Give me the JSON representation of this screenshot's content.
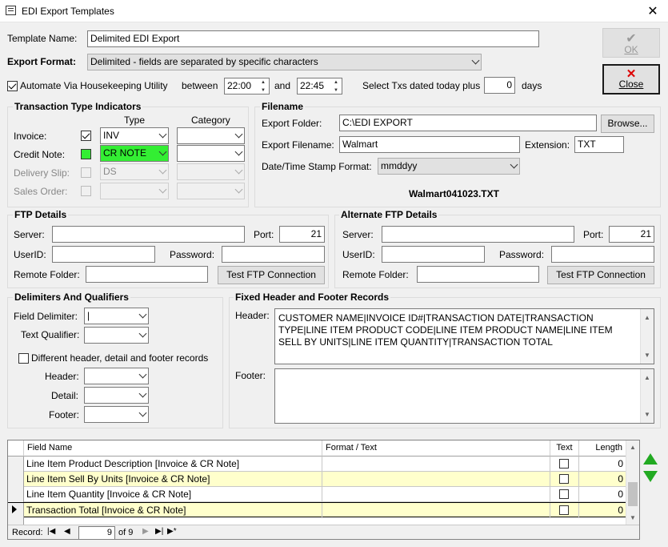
{
  "window": {
    "title": "EDI Export Templates",
    "close_glyph": "✕"
  },
  "buttons": {
    "ok": "OK",
    "close": "Close"
  },
  "template": {
    "name_label": "Template Name:",
    "name_value": "Delimited EDI Export",
    "format_label": "Export Format:",
    "format_value": "Delimited - fields are separated by specific characters"
  },
  "housekeeping": {
    "automate_label": "Automate Via Housekeeping Utility",
    "between_label": "between",
    "from_time": "22:00",
    "and_label": "and",
    "to_time": "22:45",
    "select_label": "Select Txs dated today plus",
    "days_value": "0",
    "days_label": "days"
  },
  "tti": {
    "title": "Transaction Type Indicators",
    "type_header": "Type",
    "category_header": "Category",
    "rows": [
      {
        "label": "Invoice:",
        "type": "INV"
      },
      {
        "label": "Credit Note:",
        "type": "CR NOTE"
      },
      {
        "label": "Delivery Slip:",
        "type": "DS"
      },
      {
        "label": "Sales Order:",
        "type": ""
      }
    ]
  },
  "filename": {
    "title": "Filename",
    "folder_label": "Export Folder:",
    "folder_value": "C:\\EDI EXPORT",
    "browse": "Browse...",
    "file_label": "Export Filename:",
    "file_value": "Walmart",
    "ext_label": "Extension:",
    "ext_value": "TXT",
    "stamp_label": "Date/Time Stamp Format:",
    "stamp_value": "mmddyy",
    "preview": "Walmart041023.TXT"
  },
  "ftp": {
    "title": "FTP Details",
    "server_label": "Server:",
    "port_label": "Port:",
    "port_value": "21",
    "user_label": "UserID:",
    "password_label": "Password:",
    "remote_label": "Remote Folder:",
    "test_button": "Test FTP Connection"
  },
  "alt_ftp": {
    "title": "Alternate FTP Details",
    "server_label": "Server:",
    "port_label": "Port:",
    "port_value": "21",
    "user_label": "UserID:",
    "password_label": "Password:",
    "remote_label": "Remote Folder:",
    "test_button": "Test FTP Connection"
  },
  "delim": {
    "title": "Delimiters And Qualifiers",
    "field_label": "Field Delimiter:",
    "field_value": "|",
    "qual_label": "Text Qualifier:",
    "diff_label": "Different header, detail and footer records",
    "header_label": "Header:",
    "detail_label": "Detail:",
    "footer_label": "Footer:"
  },
  "fixed": {
    "title": "Fixed Header and Footer Records",
    "header_label": "Header:",
    "header_value": "CUSTOMER NAME|INVOICE ID#|TRANSACTION DATE|TRANSACTION TYPE|LINE ITEM PRODUCT CODE|LINE ITEM PRODUCT NAME|LINE ITEM SELL BY UNITS|LINE ITEM QUANTITY|TRANSACTION TOTAL",
    "footer_label": "Footer:"
  },
  "grid": {
    "columns": [
      "Field Name",
      "Format / Text",
      "Text",
      "Length"
    ],
    "rows": [
      {
        "name": "Line Item Product Description [Invoice & CR Note]",
        "format": "",
        "length": "0"
      },
      {
        "name": "Line Item Sell By Units [Invoice & CR Note]",
        "format": "",
        "length": "0"
      },
      {
        "name": "Line Item Quantity [Invoice & CR Note]",
        "format": "",
        "length": "0"
      },
      {
        "name": "Transaction Total [Invoice & CR Note]",
        "format": "",
        "length": "0"
      }
    ]
  },
  "record_nav": {
    "label": "Record:",
    "current": "9",
    "of_label": "of 9"
  },
  "colors": {
    "green_highlight": "#33ee33",
    "row_yellow": "#ffffcc",
    "arrow_green": "#22aa22"
  }
}
